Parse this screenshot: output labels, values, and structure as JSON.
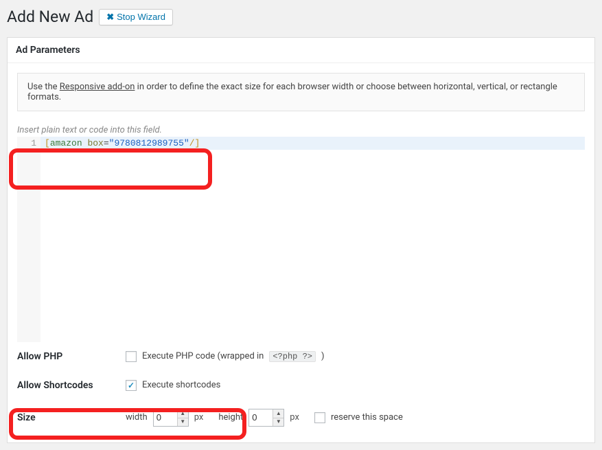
{
  "header": {
    "title": "Add New Ad",
    "stop_wizard_label": "Stop Wizard"
  },
  "panel": {
    "title": "Ad Parameters"
  },
  "notice": {
    "prefix": "Use the ",
    "link_text": "Responsive add-on",
    "suffix": " in order to define the exact size for each browser width or choose between horizontal, vertical, or rectangle formats."
  },
  "editor": {
    "hint": "Insert plain text or code into this field.",
    "line_number": "1",
    "code_open": "[",
    "code_tag": "amazon",
    "code_attr_space": " ",
    "code_attr_name": "box",
    "code_eq": "=",
    "code_str": "\"9780812989755\"",
    "code_slash": "/",
    "code_close": "]"
  },
  "rows": {
    "allow_php": {
      "label": "Allow PHP",
      "text_before": "Execute PHP code (wrapped in ",
      "chip": "<?php ?>",
      "text_after": " )",
      "checked": false
    },
    "allow_shortcodes": {
      "label": "Allow Shortcodes",
      "text": "Execute shortcodes",
      "checked": true
    },
    "size": {
      "label": "Size",
      "width_label": "width",
      "width_value": "0",
      "height_label": "height",
      "height_value": "0",
      "unit": "px",
      "reserve_label": "reserve this space",
      "reserve_checked": false
    }
  }
}
